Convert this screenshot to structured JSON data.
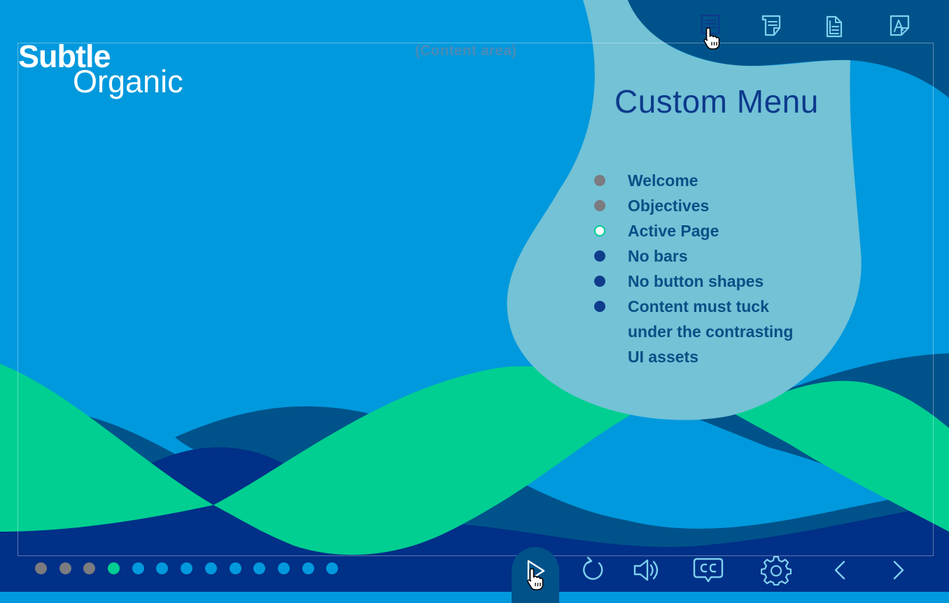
{
  "brand": {
    "line1": "Subtle",
    "line2": "Organic"
  },
  "content_area_label": "(Content area)",
  "menu": {
    "title": "Custom Menu",
    "items": [
      {
        "label": "Welcome",
        "state": "visited"
      },
      {
        "label": "Objectives",
        "state": "visited"
      },
      {
        "label": "Active Page",
        "state": "active"
      },
      {
        "label": "No bars",
        "state": "pending"
      },
      {
        "label": "No button shapes",
        "state": "pending"
      },
      {
        "label": "Content must tuck",
        "state": "pending"
      },
      {
        "label": "under the contrasting",
        "state": "none"
      },
      {
        "label": "UI assets",
        "state": "none"
      }
    ]
  },
  "top_icons": [
    "menu-icon",
    "notes-icon",
    "resources-icon",
    "glossary-icon"
  ],
  "progress": {
    "total": 13,
    "visited": 3,
    "active_index": 3
  },
  "controls": [
    "play-icon",
    "replay-icon",
    "audio-icon",
    "closed-captions-icon",
    "settings-icon",
    "previous-icon",
    "next-icon"
  ],
  "colors": {
    "sky": "#0099dd",
    "navy": "#003087",
    "deep_blue": "#00538a",
    "green": "#00cf91",
    "menu_panel": "#73c2d6",
    "menu_title": "#0d3a8c",
    "icon_light": "#7fd1f0",
    "icon_dark": "#0d3a8c"
  }
}
